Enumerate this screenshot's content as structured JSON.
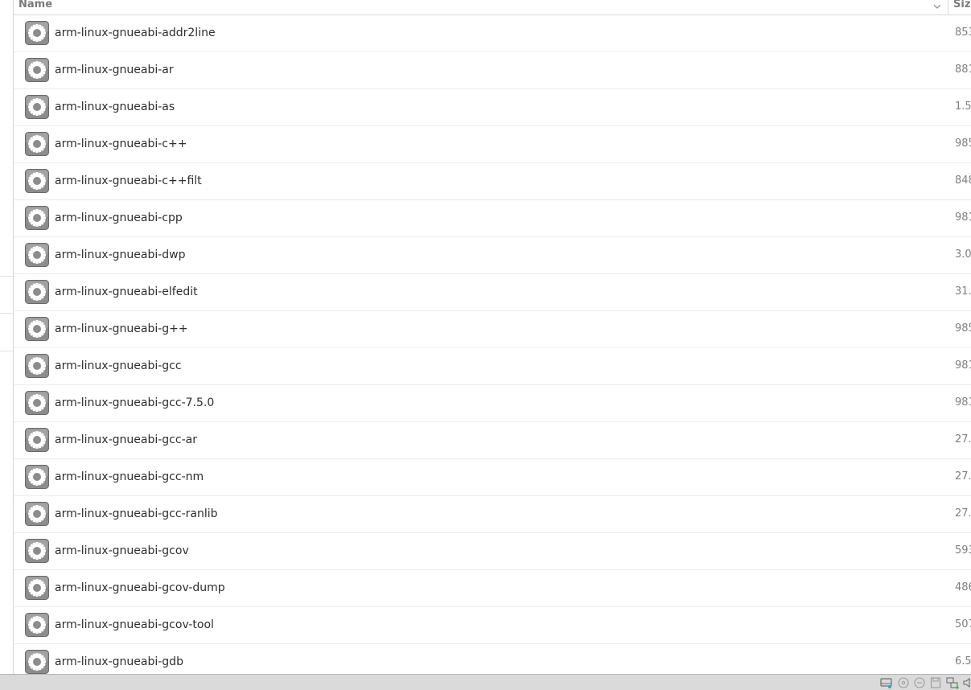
{
  "columns": {
    "name": "Name",
    "size": "Siz"
  },
  "files": [
    {
      "name": "arm-linux-gnueabi-addr2line",
      "size": "853",
      "icon": "executable-gear-icon"
    },
    {
      "name": "arm-linux-gnueabi-ar",
      "size": "881",
      "icon": "executable-gear-icon"
    },
    {
      "name": "arm-linux-gnueabi-as",
      "size": "1.5",
      "icon": "executable-gear-icon"
    },
    {
      "name": "arm-linux-gnueabi-c++",
      "size": "985",
      "icon": "executable-gear-icon"
    },
    {
      "name": "arm-linux-gnueabi-c++filt",
      "size": "848",
      "icon": "executable-gear-icon"
    },
    {
      "name": "arm-linux-gnueabi-cpp",
      "size": "981",
      "icon": "executable-gear-icon"
    },
    {
      "name": "arm-linux-gnueabi-dwp",
      "size": "3.0",
      "icon": "executable-gear-icon"
    },
    {
      "name": "arm-linux-gnueabi-elfedit",
      "size": "31.",
      "icon": "executable-gear-icon"
    },
    {
      "name": "arm-linux-gnueabi-g++",
      "size": "985",
      "icon": "executable-gear-icon"
    },
    {
      "name": "arm-linux-gnueabi-gcc",
      "size": "981",
      "icon": "executable-gear-icon"
    },
    {
      "name": "arm-linux-gnueabi-gcc-7.5.0",
      "size": "981",
      "icon": "executable-gear-icon"
    },
    {
      "name": "arm-linux-gnueabi-gcc-ar",
      "size": "27.",
      "icon": "executable-gear-icon"
    },
    {
      "name": "arm-linux-gnueabi-gcc-nm",
      "size": "27.",
      "icon": "executable-gear-icon"
    },
    {
      "name": "arm-linux-gnueabi-gcc-ranlib",
      "size": "27.",
      "icon": "executable-gear-icon"
    },
    {
      "name": "arm-linux-gnueabi-gcov",
      "size": "593",
      "icon": "executable-gear-icon"
    },
    {
      "name": "arm-linux-gnueabi-gcov-dump",
      "size": "486",
      "icon": "executable-gear-icon"
    },
    {
      "name": "arm-linux-gnueabi-gcov-tool",
      "size": "507",
      "icon": "executable-gear-icon"
    },
    {
      "name": "arm-linux-gnueabi-gdb",
      "size": "6.5",
      "icon": "executable-gear-icon"
    }
  ],
  "tray_icons": [
    "hard-disk-icon",
    "optical-disc-icon",
    "audio-icon",
    "floppy-icon",
    "network-icon",
    "speaker-icon"
  ]
}
